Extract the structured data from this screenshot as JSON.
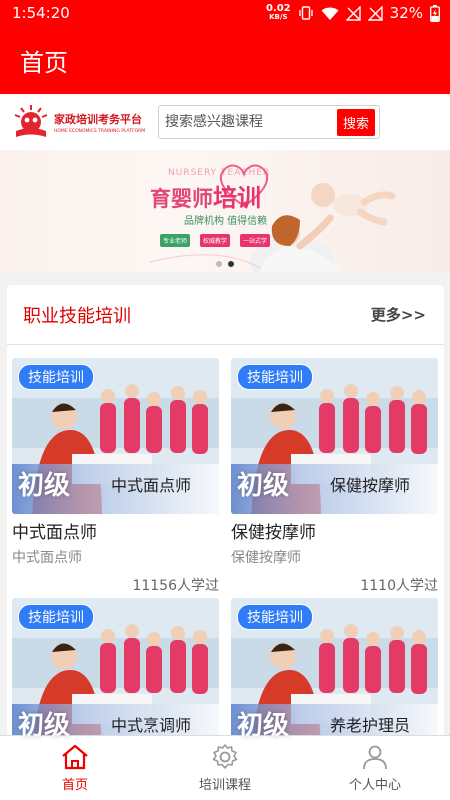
{
  "status_bar": {
    "time": "1:54:20",
    "net_speed_value": "0.02",
    "net_speed_unit": "KB/S",
    "battery": "32%"
  },
  "header": {
    "title": "首页"
  },
  "logo": {
    "cn": "家政培训考务平台",
    "en": "HOME ECONOMICS TRAINING PLATFORM"
  },
  "search": {
    "placeholder": "搜索感兴趣课程",
    "button": "搜索"
  },
  "banner": {
    "en": "NURSERY TEACHER",
    "title": "育婴师",
    "title_emph": "培训",
    "slogan": "品牌机构  值得信赖",
    "tags": [
      "专业老师",
      "权威教学",
      "一站式学"
    ],
    "active_slide": 2,
    "slide_count": 2
  },
  "section": {
    "title": "职业技能培训",
    "more": "更多>>"
  },
  "courses": [
    {
      "tag": "技能培训",
      "level": "初级",
      "thumb_name": "中式面点师",
      "title": "中式面点师",
      "subtitle": "中式面点师",
      "count": "11156人学过"
    },
    {
      "tag": "技能培训",
      "level": "初级",
      "thumb_name": "保健按摩师",
      "title": "保健按摩师",
      "subtitle": "保健按摩师",
      "count": "1110人学过"
    },
    {
      "tag": "技能培训",
      "level": "初级",
      "thumb_name": "中式烹调师",
      "title": "",
      "subtitle": "",
      "count": ""
    },
    {
      "tag": "技能培训",
      "level": "初级",
      "thumb_name": "养老护理员",
      "title": "",
      "subtitle": "",
      "count": ""
    }
  ],
  "bottom_nav": [
    {
      "label": "首页",
      "icon": "home-icon",
      "active": true
    },
    {
      "label": "培训课程",
      "icon": "gear-icon",
      "active": false
    },
    {
      "label": "个人中心",
      "icon": "user-icon",
      "active": false
    }
  ],
  "colors": {
    "primary": "#ff0000",
    "tag_blue": "#2f7cf6",
    "section_title": "#e00000"
  }
}
